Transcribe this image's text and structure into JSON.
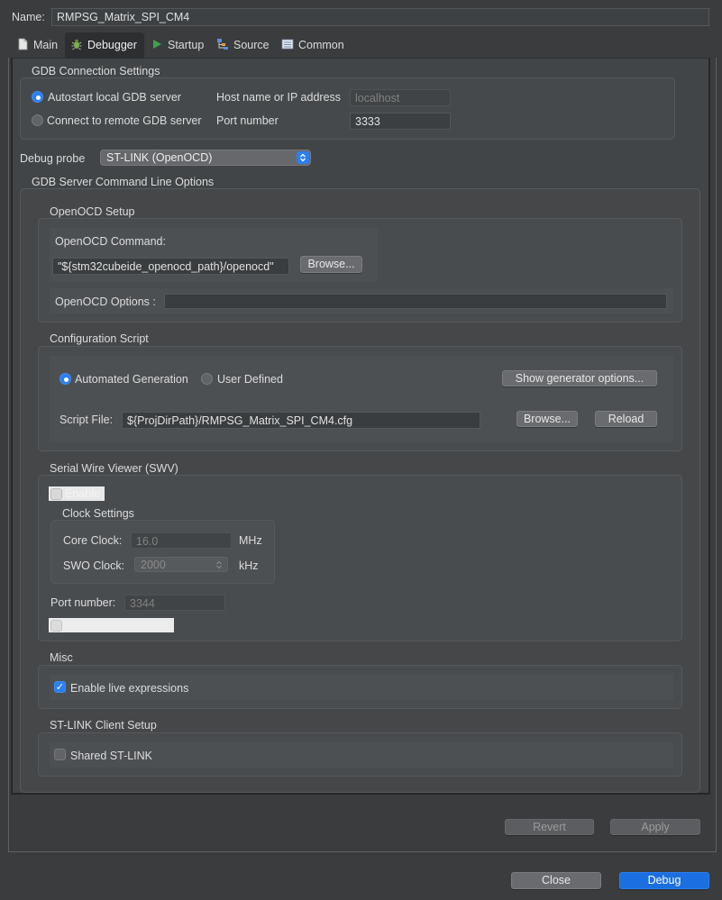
{
  "name": {
    "label": "Name:",
    "value": "RMPSG_Matrix_SPI_CM4"
  },
  "tabs": [
    {
      "label": "Main"
    },
    {
      "label": "Debugger"
    },
    {
      "label": "Startup"
    },
    {
      "label": "Source"
    },
    {
      "label": "Common"
    }
  ],
  "gdb_connection": {
    "title": "GDB Connection Settings",
    "autostart_label": "Autostart local GDB server",
    "remote_label": "Connect to remote GDB server",
    "host_label": "Host name or IP address",
    "host_value": "localhost",
    "port_label": "Port number",
    "port_value": "3333"
  },
  "debug_probe": {
    "label": "Debug probe",
    "value": "ST-LINK (OpenOCD)"
  },
  "server_options": {
    "title": "GDB Server Command Line Options"
  },
  "openocd": {
    "title": "OpenOCD Setup",
    "command_label": "OpenOCD Command:",
    "command_value": "\"${stm32cubeide_openocd_path}/openocd\"",
    "browse_label": "Browse...",
    "options_label": "OpenOCD Options :",
    "options_value": ""
  },
  "config_script": {
    "title": "Configuration Script",
    "automated_label": "Automated Generation",
    "user_defined_label": "User Defined",
    "show_generator_label": "Show generator options...",
    "script_file_label": "Script File:",
    "script_file_value": "${ProjDirPath}/RMPSG_Matrix_SPI_CM4.cfg",
    "browse_label": "Browse...",
    "reload_label": "Reload"
  },
  "swv": {
    "title": "Serial Wire Viewer (SWV)",
    "enable_label": "Enable",
    "clock_title": "Clock Settings",
    "core_clock_label": "Core Clock:",
    "core_clock_value": "16.0",
    "core_clock_unit": "MHz",
    "swo_clock_label": "SWO Clock:",
    "swo_clock_value": "2000",
    "swo_clock_unit": "kHz",
    "port_label": "Port number:",
    "port_value": "3344"
  },
  "misc": {
    "title": "Misc",
    "live_expr_label": "Enable live expressions"
  },
  "stlink_client": {
    "title": "ST-LINK Client Setup",
    "shared_label": "Shared ST-LINK"
  },
  "footer": {
    "revert_label": "Revert",
    "apply_label": "Apply",
    "close_label": "Close",
    "debug_label": "Debug"
  },
  "colors": {
    "accent": "#2b7ff0",
    "primary_button": "#1b6fe0"
  }
}
